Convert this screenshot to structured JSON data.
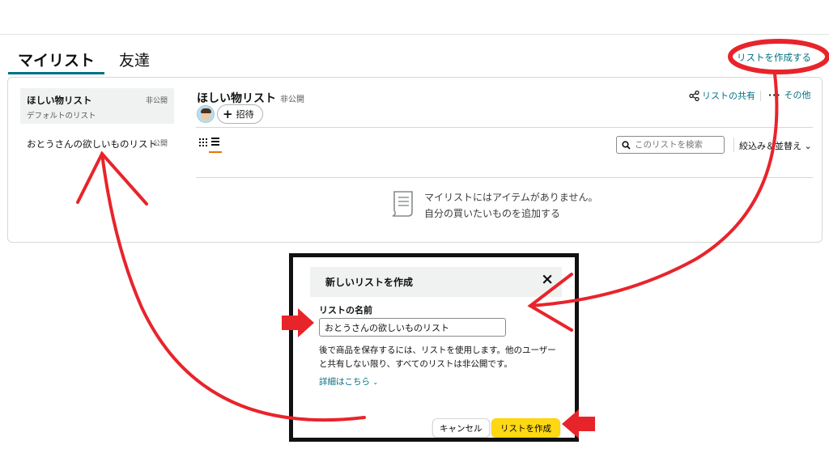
{
  "tabs": {
    "mylist": "マイリスト",
    "friends": "友達"
  },
  "header": {
    "create_list": "リストを作成する"
  },
  "sidebar": {
    "items": [
      {
        "name": "ほしい物リスト",
        "badge": "非公開",
        "subtitle": "デフォルトのリスト"
      },
      {
        "name": "おとうさんの欲しいものリスト",
        "badge": "公開"
      }
    ]
  },
  "list": {
    "title": "ほしい物リスト",
    "privacy": "非公開",
    "invite": "招待",
    "share": "リストの共有",
    "more": "その他",
    "search_placeholder": "このリストを検索",
    "filter": "絞込み＆並替え",
    "empty_line1": "マイリストにはアイテムがありません。",
    "empty_line2": "自分の買いたいものを追加する"
  },
  "modal": {
    "title": "新しいリストを作成",
    "field_label": "リストの名前",
    "name_value": "おとうさんの欲しいものリスト",
    "help_text": "後で商品を保存するには、リストを使用します。他のユーザーと共有しない限り、すべてのリストは非公開です。",
    "details_link": "詳細はこちら",
    "cancel": "キャンセル",
    "create": "リストを作成"
  },
  "colors": {
    "link": "#007185",
    "tab_underline": "#007185",
    "primary_button": "#ffd814",
    "annotation_red": "#e8242b",
    "modal_frame": "#111111"
  },
  "icons": {
    "share": "share-icon",
    "more": "more-dots-icon",
    "search": "search-icon",
    "close": "close-icon",
    "grid_view": "grid-view-icon",
    "list_view": "list-view-icon",
    "empty_list": "document-icon",
    "chevron": "chevron-down-icon",
    "plus": "plus-icon"
  }
}
